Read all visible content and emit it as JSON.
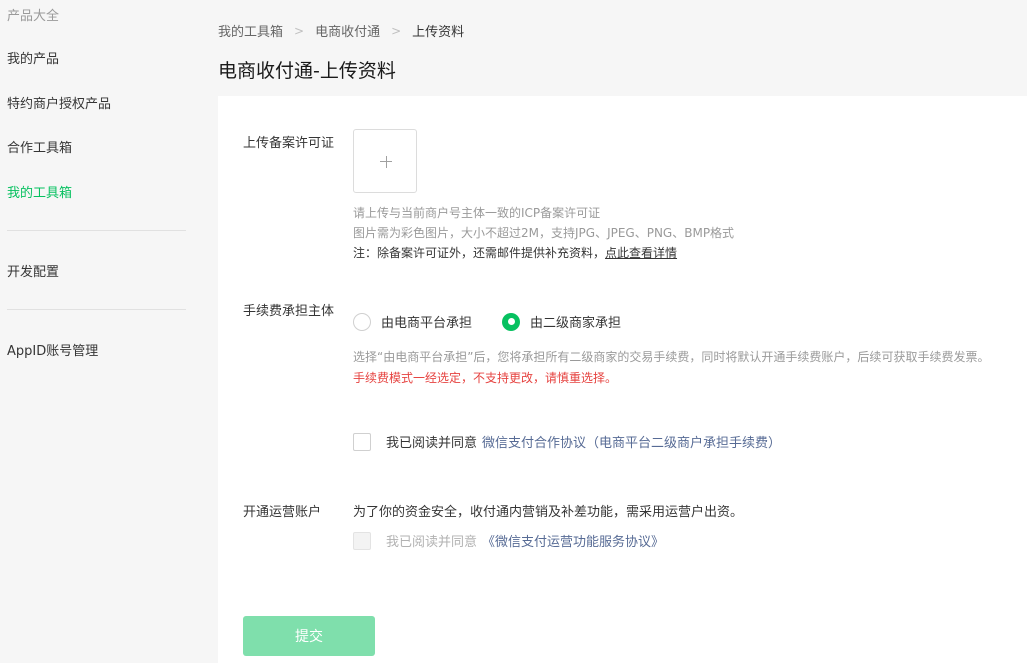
{
  "sidebar": {
    "header": "产品大全",
    "items": [
      "我的产品",
      "特约商户授权产品",
      "合作工具箱",
      "我的工具箱"
    ],
    "dev_config": "开发配置",
    "appid_mgmt": "AppID账号管理"
  },
  "breadcrumb": [
    "我的工具箱",
    "电商收付通",
    "上传资料"
  ],
  "page_title": "电商收付通-上传资料",
  "upload": {
    "label": "上传备案许可证",
    "plus_icon": "+",
    "hint1": "请上传与当前商户号主体一致的ICP备案许可证",
    "hint2": "图片需为彩色图片，大小不超过2M，支持JPG、JPEG、PNG、BMP格式",
    "note": "注：除备案许可证外，还需邮件提供补充资料，",
    "note_link": "点此查看详情"
  },
  "fee": {
    "label": "手续费承担主体",
    "options": [
      "由电商平台承担",
      "由二级商家承担"
    ],
    "selected_index": 1,
    "hint": "选择“由电商平台承担”后，您将承担所有二级商家的交易手续费，同时将默认开通手续费账户，后续可获取手续费发票。",
    "warning": "手续费模式一经选定，不支持更改，请慎重选择。"
  },
  "agreement1": {
    "checked": false,
    "prefix": "我已阅读并同意",
    "link": "微信支付合作协议（电商平台二级商户承担手续费）"
  },
  "ops": {
    "label": "开通运营账户",
    "text": "为了你的资金安全，收付通内营销及补差功能，需采用运营户出资。",
    "checked": false,
    "prefix": "我已阅读并同意",
    "link": "《微信支付运营功能服务协议》"
  },
  "submit_label": "提交",
  "colors": {
    "accent": "#07c160",
    "submit_disabled": "#7fdfac",
    "warning": "#e64340",
    "link": "#576b95"
  }
}
